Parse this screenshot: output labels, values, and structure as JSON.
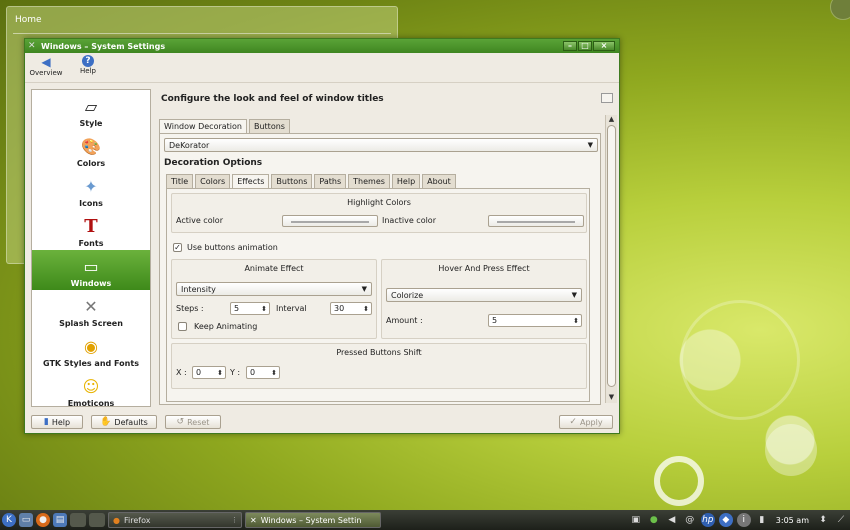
{
  "desktop": {
    "bg_window_title": "Home"
  },
  "window": {
    "title": "Windows – System Settings",
    "minimize_glyph": "–",
    "maximize_glyph": "□",
    "close_glyph": "×"
  },
  "toolbar": {
    "overview": "Overview",
    "help": "Help"
  },
  "sidebar": {
    "items": [
      {
        "label": "Style",
        "icon": "style-icon",
        "glyph": "▱"
      },
      {
        "label": "Colors",
        "icon": "colors-icon",
        "glyph": "🎨"
      },
      {
        "label": "Icons",
        "icon": "icons-icon",
        "glyph": "✦"
      },
      {
        "label": "Fonts",
        "icon": "fonts-icon",
        "glyph": "T"
      },
      {
        "label": "Windows",
        "icon": "windows-icon",
        "glyph": "▭"
      },
      {
        "label": "Splash Screen",
        "icon": "splash-screen-icon",
        "glyph": "✕"
      },
      {
        "label": "GTK Styles and Fonts",
        "icon": "gtk-icon",
        "glyph": "◉"
      },
      {
        "label": "Emoticons",
        "icon": "emoticons-icon",
        "glyph": "☺"
      }
    ],
    "selected": "Windows"
  },
  "content": {
    "heading": "Configure the look and feel of window titles",
    "top_tabs": [
      "Window Decoration",
      "Buttons"
    ],
    "decoration_value": "DeKorator",
    "options_title": "Decoration Options",
    "inner_tabs": [
      "Title",
      "Colors",
      "Effects",
      "Buttons",
      "Paths",
      "Themes",
      "Help",
      "About"
    ],
    "active_inner_tab": "Effects",
    "highlight": {
      "title": "Highlight Colors",
      "active_label": "Active color",
      "inactive_label": "Inactive color"
    },
    "use_buttons_animation": "Use buttons animation",
    "animate": {
      "title": "Animate Effect",
      "effect_value": "Intensity",
      "steps_label": "Steps :",
      "steps_value": "5",
      "interval_label": "Interval",
      "interval_value": "30",
      "keep_animating": "Keep Animating"
    },
    "hover": {
      "title": "Hover And Press Effect",
      "effect_value": "Colorize",
      "amount_label": "Amount :",
      "amount_value": "5"
    },
    "pressed": {
      "title": "Pressed Buttons Shift",
      "x_label": "X :",
      "x_value": "0",
      "y_label": "Y :",
      "y_value": "0"
    }
  },
  "bottom": {
    "help": "Help",
    "defaults": "Defaults",
    "reset": "Reset",
    "apply": "Apply"
  },
  "taskbar": {
    "tasks": [
      "Firefox",
      "Windows – System Settin"
    ],
    "clock": "3:05 am"
  },
  "colors": {
    "accent": "#3f8621",
    "selection": "#4f9a26"
  }
}
